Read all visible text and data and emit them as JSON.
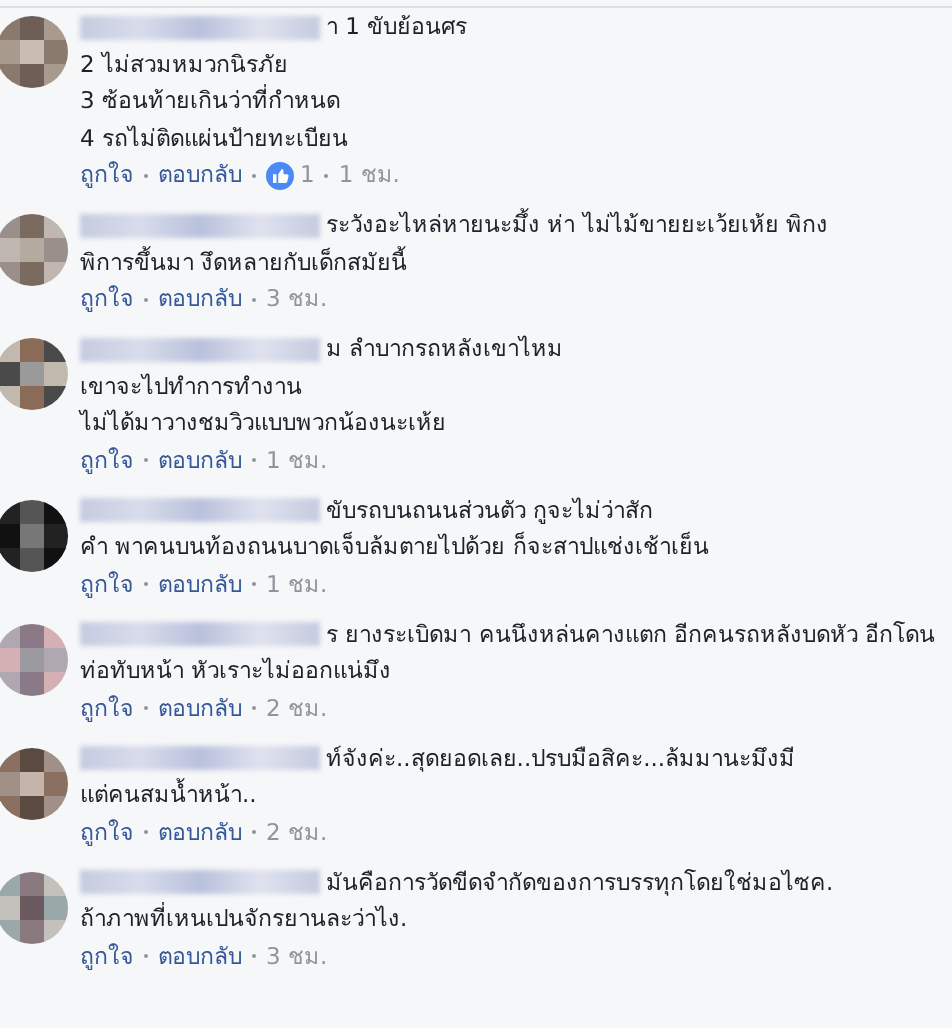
{
  "comments": [
    {
      "lines": [
        "า 1 ขับย้อนศร",
        "2 ไม่สวมหมวกนิรภัย",
        "3 ซ้อนท้ายเกินว่าที่กำหนด",
        "4 รถไม่ติดแผ่นป้ายทะเบียน"
      ],
      "like": "ถูกใจ",
      "reply": "ตอบกลับ",
      "reaction_count": "1",
      "time": "1 ชม."
    },
    {
      "lines": [
        "ระวังอะไหล่หายนะมึ้ง ห่า ไม่ไม้ขายยะเว้ยเห้ย พิกง",
        "พิการขึ้นมา งึดหลายกับเด็กสมัยนี้"
      ],
      "like": "ถูกใจ",
      "reply": "ตอบกลับ",
      "time": "3 ชม."
    },
    {
      "lines": [
        "ม ลำบากรถหลังเขาไหม",
        "เขาจะไปทำการทำงาน",
        "ไม่ได้มาวางชมวิวแบบพวกน้องนะเห้ย"
      ],
      "like": "ถูกใจ",
      "reply": "ตอบกลับ",
      "time": "1 ชม."
    },
    {
      "lines": [
        "ขับรถบนถนนส่วนตัว กูจะไม่ว่าสัก",
        "คำ พาคนบนท้องถนนบาดเจ็บล้มตายไปด้วย ก็จะสาปแช่งเช้าเย็น"
      ],
      "like": "ถูกใจ",
      "reply": "ตอบกลับ",
      "time": "1 ชม."
    },
    {
      "lines": [
        "ร ยางระเบิดมา คนนึงหล่นคางแตก อีกคนรถหลังบดหัว อีกโดน",
        "ท่อทับหน้า หัวเราะไม่ออกแน่มึง"
      ],
      "like": "ถูกใจ",
      "reply": "ตอบกลับ",
      "time": "2 ชม."
    },
    {
      "lines": [
        "ท์จังค่ะ..สุดยอดเลย..ปรบมือสิคะ...ล้มมานะมึงมี",
        "แต่คนสมน้ำหน้า.."
      ],
      "like": "ถูกใจ",
      "reply": "ตอบกลับ",
      "time": "2 ชม."
    },
    {
      "lines": [
        "มันคือการวัดขีดจำกัดของการบรรทุกโดยใช่มอไซค.",
        "ถ้าภาพที่เหนเปนจักรยานละว่าไง."
      ],
      "like": "ถูกใจ",
      "reply": "ตอบกลับ",
      "time": "3 ชม."
    }
  ]
}
